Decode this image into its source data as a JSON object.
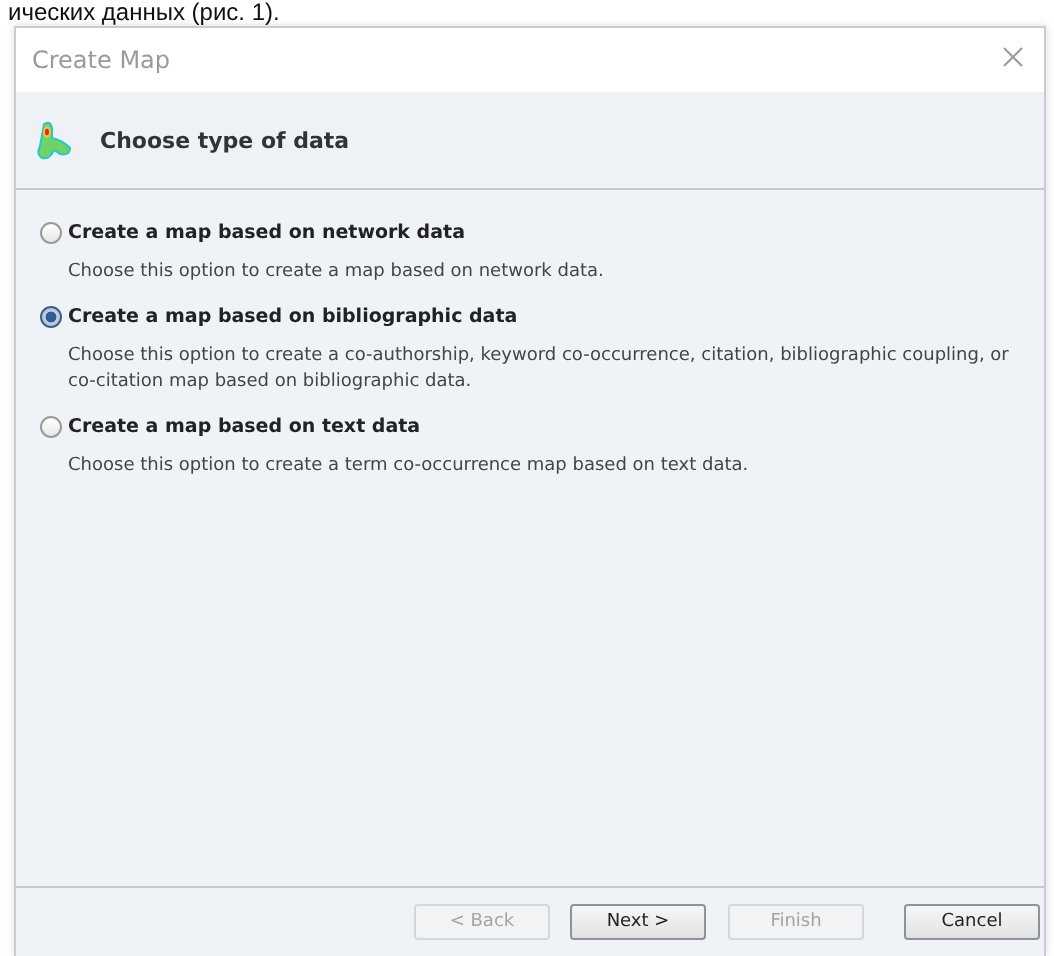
{
  "document_text": "ических данных (рис. 1).",
  "window": {
    "title": "Create Map"
  },
  "header": {
    "title": "Choose type of data"
  },
  "options": [
    {
      "label": "Create a map based on network data",
      "description": "Choose this option to create a map based on network data.",
      "selected": false
    },
    {
      "label": "Create a map based on bibliographic data",
      "description": "Choose this option to create a co-authorship, keyword co-occurrence, citation, bibliographic coupling, or co-citation map based on bibliographic data.",
      "selected": true
    },
    {
      "label": "Create a map based on text data",
      "description": "Choose this option to create a term co-occurrence map based on text data.",
      "selected": false
    }
  ],
  "buttons": [
    {
      "label": "< Back",
      "disabled": true
    },
    {
      "label": "Next >",
      "disabled": false
    },
    {
      "label": "Finish",
      "disabled": true
    },
    {
      "label": "Cancel",
      "disabled": false
    }
  ]
}
